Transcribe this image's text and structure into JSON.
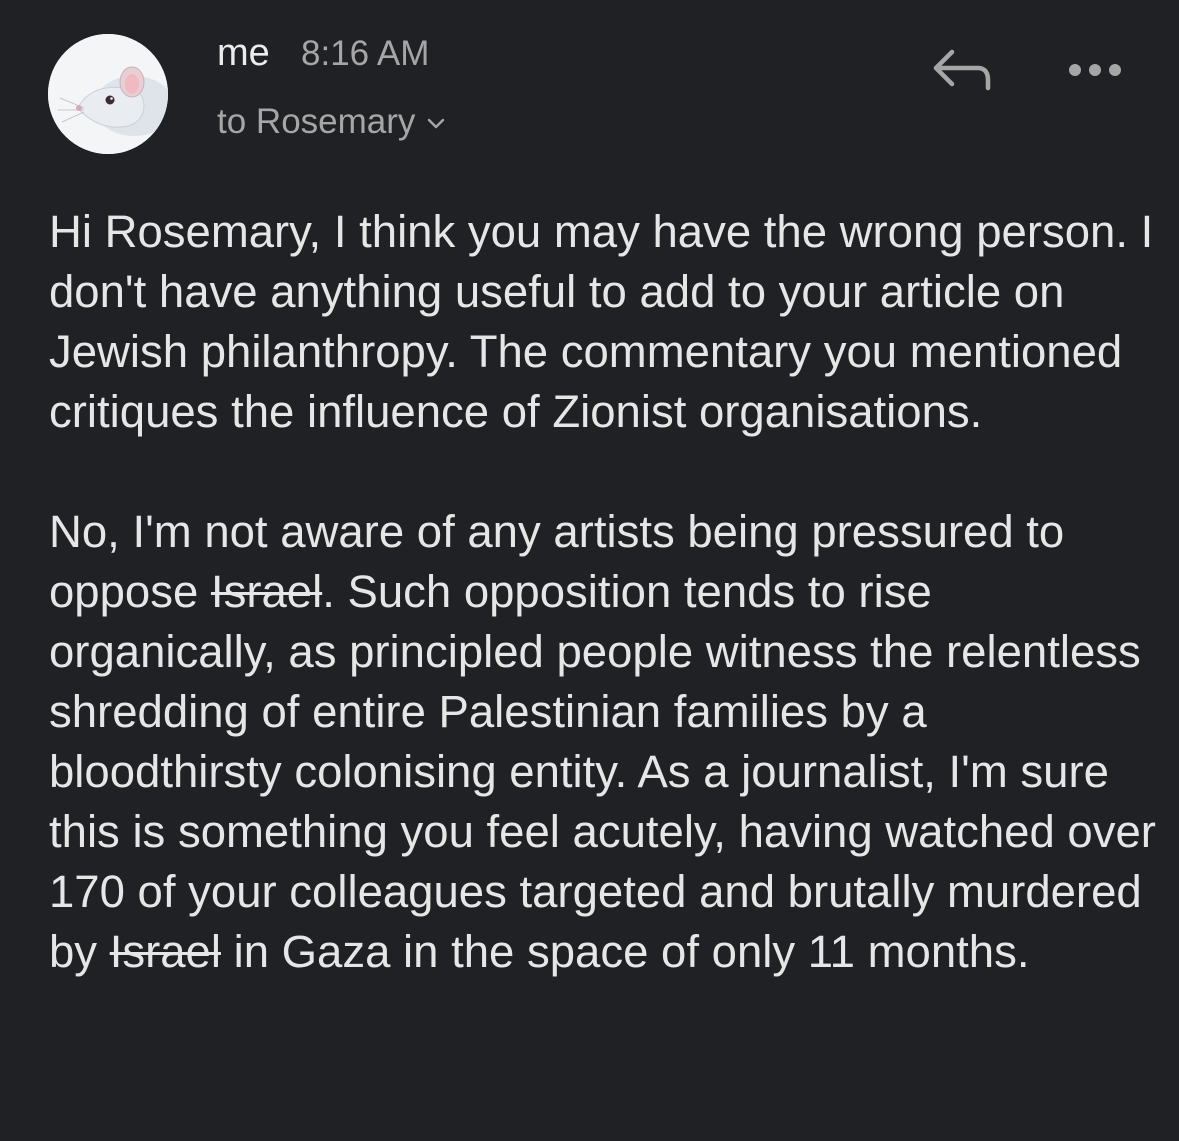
{
  "message": {
    "sender": "me",
    "time": "8:16 AM",
    "recipient_line": "to Rosemary",
    "paragraph1": "Hi Rosemary, I think you may have the wrong person. I don't have anything useful to add to your article on Jewish philanthropy. The commentary you mentioned critiques the influence of Zionist organisations.",
    "paragraph2": {
      "part1": "No, I'm not aware of any artists being pressured to oppose ",
      "strike1": "Israel",
      "part2": ". Such opposition tends to rise organically, as principled people witness the relentless shredding of entire Palestinian families by a bloodthirsty colonising entity. As a journalist, I'm sure this is something you feel acutely, having watched over 170 of your colleagues targeted and brutally murdered by ",
      "strike2": "Israel",
      "part3": " in Gaza in the space of only 11 months."
    }
  },
  "icons": {
    "avatar": "rat-avatar-image",
    "reply": "reply-arrow-icon",
    "more": "more-options-icon",
    "expand": "chevron-down-icon"
  },
  "colors": {
    "background": "#202124",
    "text_primary": "#e6e6e6",
    "text_secondary": "#a6a6a6"
  }
}
